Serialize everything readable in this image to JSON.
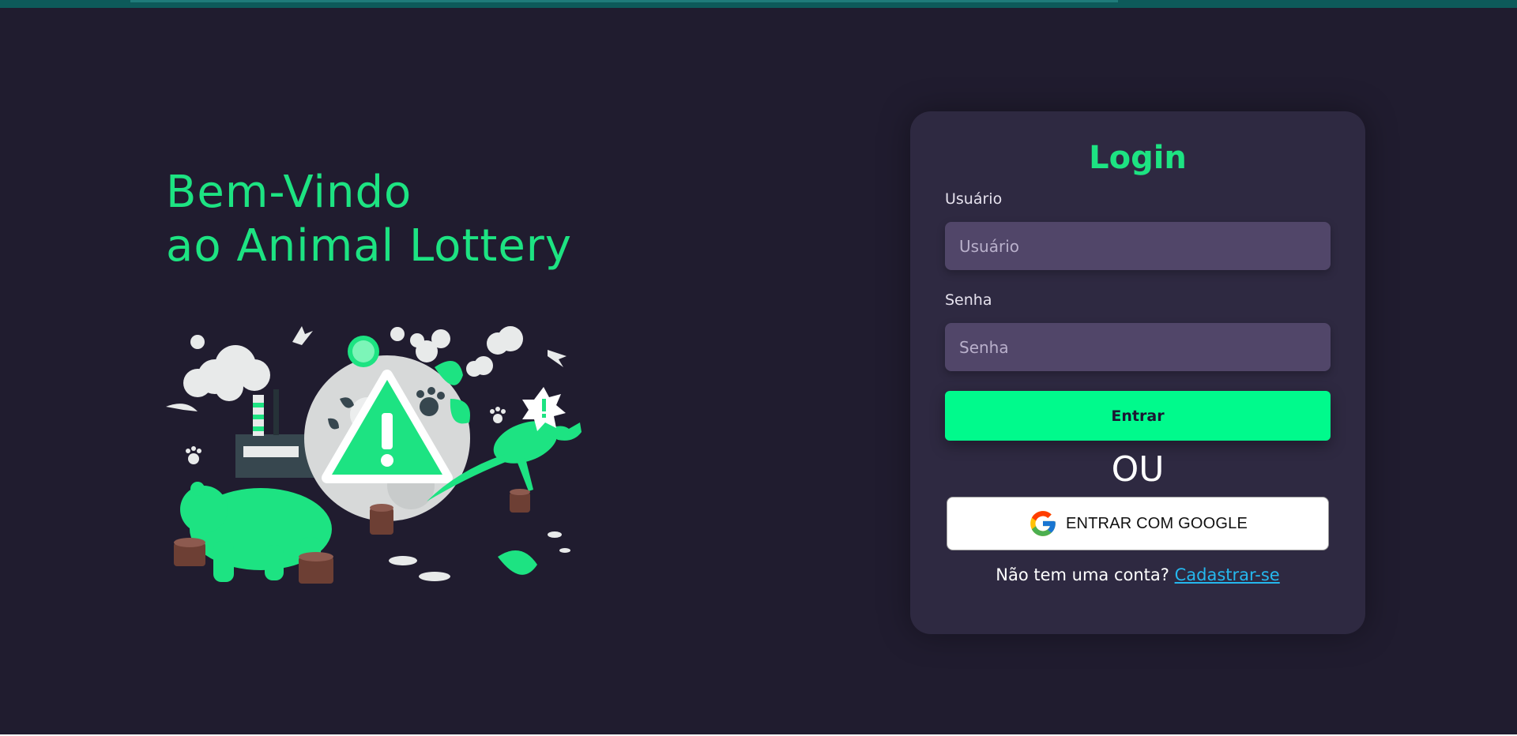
{
  "welcome": {
    "line1": "Bem-Vindo",
    "line2": "ao Animal Lottery"
  },
  "login": {
    "title": "Login",
    "username_label": "Usuário",
    "username_placeholder": "Usuário",
    "username_value": "",
    "password_label": "Senha",
    "password_placeholder": "Senha",
    "password_value": "",
    "submit_label": "Entrar",
    "or_text": "OU",
    "google_label": "ENTRAR COM GOOGLE",
    "signup_prompt": "Não tem uma conta?",
    "signup_link": "Cadastrar-se"
  },
  "illustration": {
    "icon": "endangered-animals-warning-illustration"
  },
  "colors": {
    "background": "#201c2f",
    "card": "#2e2941",
    "accent": "#00fa8c",
    "heading": "#1de382",
    "input": "#514669",
    "link": "#25b8ee"
  }
}
